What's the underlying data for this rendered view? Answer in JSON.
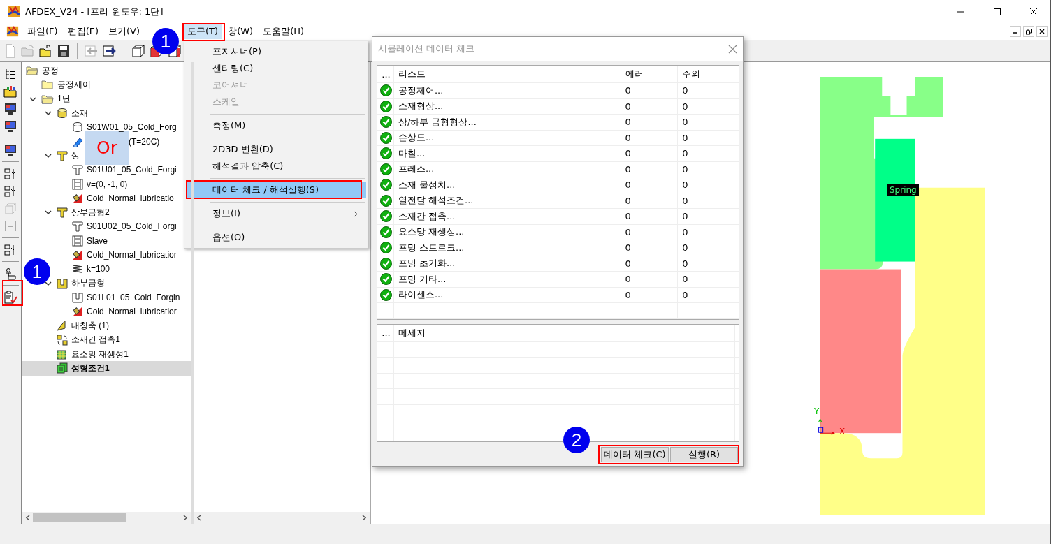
{
  "window": {
    "title": "AFDEX_V24 - [프리 윈도우: 1단]"
  },
  "menu_bar": [
    {
      "label": "파일(F)",
      "selected": false
    },
    {
      "label": "편집(E)",
      "selected": false
    },
    {
      "label": "보기(V)",
      "selected": false
    },
    {
      "label": "도구(T)",
      "selected": true
    },
    {
      "label": "창(W)",
      "selected": false
    },
    {
      "label": "도움말(H)",
      "selected": false
    }
  ],
  "tree": [
    {
      "label": "공정",
      "kind": "folder-open",
      "selected": false,
      "children": [
        {
          "label": "공정제어",
          "kind": "folder",
          "selected": false
        },
        {
          "label": "1단",
          "kind": "folder-open",
          "selected": false,
          "expanded": true,
          "children": [
            {
              "label": "소재",
              "kind": "material",
              "selected": false,
              "expanded": true,
              "children": [
                {
                  "label": "S01W01_05_Cold_Forg",
                  "kind": "billet",
                  "selected": false
                },
                {
                  "label": "(T=20C)",
                  "kind": "temperature",
                  "selected": false,
                  "partly_hidden": true
                }
              ]
            },
            {
              "label": "상",
              "kind": "die-upper",
              "selected": false,
              "expanded": true,
              "children": [
                {
                  "label": "S01U01_05_Cold_Forgi",
                  "kind": "die-part",
                  "selected": false
                },
                {
                  "label": "v=(0, -1, 0)",
                  "kind": "velocity",
                  "selected": false
                },
                {
                  "label": "Cold_Normal_lubricatio",
                  "kind": "lubricant",
                  "selected": false
                }
              ]
            },
            {
              "label": "상부금형2",
              "kind": "die-upper",
              "selected": false,
              "expanded": true,
              "children": [
                {
                  "label": "S01U02_05_Cold_Forgi",
                  "kind": "die-part",
                  "selected": false
                },
                {
                  "label": "Slave",
                  "kind": "velocity",
                  "selected": false
                },
                {
                  "label": "Cold_Normal_lubricatior",
                  "kind": "lubricant",
                  "selected": false
                },
                {
                  "label": "k=100",
                  "kind": "spring",
                  "selected": false
                }
              ]
            },
            {
              "label": "하부금형",
              "kind": "die-lower",
              "selected": false,
              "expanded": true,
              "children": [
                {
                  "label": "S01L01_05_Cold_Forgin",
                  "kind": "die-lower-part",
                  "selected": false
                },
                {
                  "label": "Cold_Normal_lubricatior",
                  "kind": "lubricant",
                  "selected": false
                }
              ]
            },
            {
              "label": "대칭축 (1)",
              "kind": "symmetry",
              "selected": false
            },
            {
              "label": "소재간 접촉1",
              "kind": "contact",
              "selected": false
            },
            {
              "label": "요소망 재생성1",
              "kind": "remesh",
              "selected": false
            },
            {
              "label": "성형조건1",
              "kind": "condition",
              "selected": true
            }
          ]
        }
      ]
    }
  ],
  "tools_menu": [
    {
      "kind": "item",
      "label": "포지셔너(P)",
      "disabled": false,
      "selected": false,
      "submenu": false
    },
    {
      "kind": "item",
      "label": "센터링(C)",
      "disabled": false,
      "selected": false,
      "submenu": false
    },
    {
      "kind": "item",
      "label": "코어셔너",
      "disabled": true,
      "selected": false,
      "submenu": false
    },
    {
      "kind": "item",
      "label": "스케일",
      "disabled": true,
      "selected": false,
      "submenu": false
    },
    {
      "kind": "separator"
    },
    {
      "kind": "item",
      "label": "측정(M)",
      "disabled": false,
      "selected": false,
      "submenu": false
    },
    {
      "kind": "separator"
    },
    {
      "kind": "item",
      "label": "2D3D 변환(D)",
      "disabled": false,
      "selected": false,
      "submenu": false
    },
    {
      "kind": "item",
      "label": "해석결과 압축(C)",
      "disabled": false,
      "selected": false,
      "submenu": false
    },
    {
      "kind": "separator"
    },
    {
      "kind": "item",
      "label": "데이터 체크 / 해석실행(S)",
      "disabled": false,
      "selected": true,
      "submenu": false
    },
    {
      "kind": "separator"
    },
    {
      "kind": "item",
      "label": "정보(I)",
      "disabled": false,
      "selected": false,
      "submenu": true
    },
    {
      "kind": "separator"
    },
    {
      "kind": "item",
      "label": "옵션(O)",
      "disabled": false,
      "selected": false,
      "submenu": false
    }
  ],
  "dialog": {
    "title": "시뮬레이션 데이터 체크",
    "columns": [
      "...",
      "리스트",
      "에러",
      "주의"
    ],
    "rows": [
      {
        "passed": true,
        "item": "공정제어...",
        "errors": "0",
        "warnings": "0"
      },
      {
        "passed": true,
        "item": "소재형상...",
        "errors": "0",
        "warnings": "0"
      },
      {
        "passed": true,
        "item": "상/하부 금형형상...",
        "errors": "0",
        "warnings": "0"
      },
      {
        "passed": true,
        "item": "손상도...",
        "errors": "0",
        "warnings": "0"
      },
      {
        "passed": true,
        "item": "마찰...",
        "errors": "0",
        "warnings": "0"
      },
      {
        "passed": true,
        "item": "프레스...",
        "errors": "0",
        "warnings": "0"
      },
      {
        "passed": true,
        "item": "소재 물성치...",
        "errors": "0",
        "warnings": "0"
      },
      {
        "passed": true,
        "item": "열전달 해석조건...",
        "errors": "0",
        "warnings": "0"
      },
      {
        "passed": true,
        "item": "소재간 접촉...",
        "errors": "0",
        "warnings": "0"
      },
      {
        "passed": true,
        "item": "요소망 재생성...",
        "errors": "0",
        "warnings": "0"
      },
      {
        "passed": true,
        "item": "포밍 스트로크...",
        "errors": "0",
        "warnings": "0"
      },
      {
        "passed": true,
        "item": "포밍 초기화...",
        "errors": "0",
        "warnings": "0"
      },
      {
        "passed": true,
        "item": "포밍 기타...",
        "errors": "0",
        "warnings": "0"
      },
      {
        "passed": true,
        "item": "라이센스...",
        "errors": "0",
        "warnings": "0"
      }
    ],
    "message_columns": [
      "...",
      "메세지"
    ],
    "buttons": [
      "데이터 체크(C)",
      "실행(R)"
    ]
  },
  "viewport": {
    "part_label": "Spring",
    "axis_x": "X",
    "axis_y": "Y"
  },
  "annotations": {
    "steps": [
      "1",
      "1",
      "2"
    ],
    "or_label": "Or"
  }
}
